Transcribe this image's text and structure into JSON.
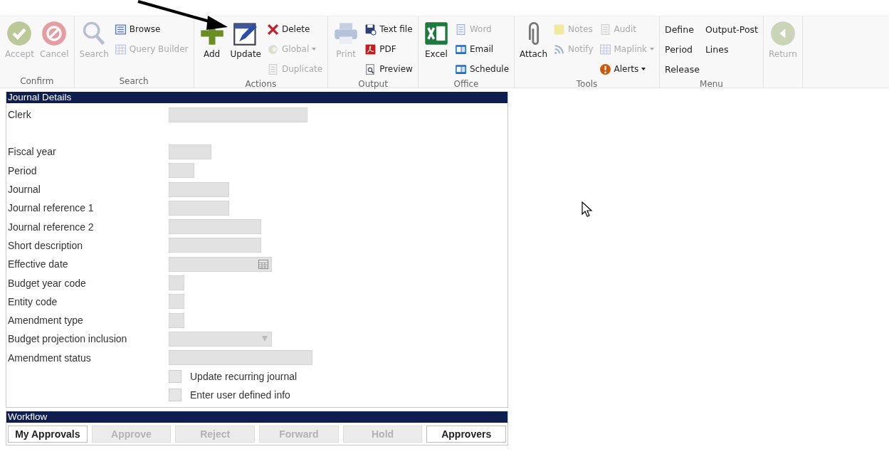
{
  "ribbon": {
    "groups": [
      {
        "label": "Confirm",
        "columns": [
          {
            "items": [
              {
                "kind": "large",
                "label": "Accept",
                "disabled": true
              }
            ]
          },
          {
            "items": [
              {
                "kind": "large",
                "label": "Cancel",
                "disabled": true
              }
            ]
          }
        ]
      },
      {
        "label": "Search",
        "columns": [
          {
            "items": [
              {
                "kind": "large",
                "label": "Search",
                "disabled": true
              }
            ]
          },
          {
            "items": [
              {
                "kind": "small",
                "label": "Browse",
                "disabled": false
              },
              {
                "kind": "small",
                "label": "Query Builder",
                "disabled": true
              }
            ]
          }
        ]
      },
      {
        "label": "Actions",
        "columns": [
          {
            "items": [
              {
                "kind": "large",
                "label": "Add",
                "disabled": false
              }
            ]
          },
          {
            "items": [
              {
                "kind": "large",
                "label": "Update",
                "disabled": false
              }
            ]
          },
          {
            "items": [
              {
                "kind": "small",
                "label": "Delete",
                "disabled": false
              },
              {
                "kind": "small",
                "label": "Global",
                "disabled": true,
                "dropdown": true
              },
              {
                "kind": "small",
                "label": "Duplicate",
                "disabled": true
              }
            ]
          }
        ]
      },
      {
        "label": "Output",
        "columns": [
          {
            "items": [
              {
                "kind": "large",
                "label": "Print",
                "disabled": true
              }
            ]
          },
          {
            "items": [
              {
                "kind": "small",
                "label": "Text file",
                "disabled": false
              },
              {
                "kind": "small",
                "label": "PDF",
                "disabled": false
              },
              {
                "kind": "small",
                "label": "Preview",
                "disabled": false
              }
            ]
          }
        ]
      },
      {
        "label": "Office",
        "columns": [
          {
            "items": [
              {
                "kind": "large",
                "label": "Excel",
                "disabled": false
              }
            ]
          },
          {
            "items": [
              {
                "kind": "small",
                "label": "Word",
                "disabled": true
              },
              {
                "kind": "small",
                "label": "Email",
                "disabled": false
              },
              {
                "kind": "small",
                "label": "Schedule",
                "disabled": false
              }
            ]
          }
        ]
      },
      {
        "label": "Tools",
        "columns": [
          {
            "items": [
              {
                "kind": "large",
                "label": "Attach",
                "disabled": false
              }
            ]
          },
          {
            "items": [
              {
                "kind": "small",
                "label": "Notes",
                "disabled": true
              },
              {
                "kind": "small",
                "label": "Notify",
                "disabled": true
              }
            ]
          },
          {
            "items": [
              {
                "kind": "small",
                "label": "Audit",
                "disabled": true
              },
              {
                "kind": "small",
                "label": "Maplink",
                "disabled": true,
                "dropdown": true
              },
              {
                "kind": "small",
                "label": "Alerts",
                "disabled": false,
                "dropdown": true
              }
            ]
          }
        ]
      },
      {
        "label": "Menu",
        "columns": [
          {
            "items": [
              {
                "kind": "text",
                "label": "Define",
                "disabled": false
              },
              {
                "kind": "text",
                "label": "Period",
                "disabled": false
              },
              {
                "kind": "text",
                "label": "Release",
                "disabled": false
              }
            ]
          },
          {
            "items": [
              {
                "kind": "text",
                "label": "Output-Post",
                "disabled": false
              },
              {
                "kind": "text",
                "label": "Lines",
                "disabled": false
              }
            ]
          }
        ]
      },
      {
        "columns": [
          {
            "items": [
              {
                "kind": "large",
                "label": "Return",
                "disabled": true
              }
            ]
          }
        ]
      }
    ]
  },
  "form": {
    "title": "Journal Details",
    "fields": [
      {
        "kind": "text",
        "label": "Clerk",
        "disabled": true
      },
      {
        "kind": "text",
        "label": "Fiscal year",
        "disabled": true
      },
      {
        "kind": "text",
        "label": "Period",
        "disabled": true
      },
      {
        "kind": "text",
        "label": "Journal",
        "disabled": true
      },
      {
        "kind": "text",
        "label": "Journal reference 1",
        "disabled": true
      },
      {
        "kind": "text",
        "label": "Journal reference 2",
        "disabled": true
      },
      {
        "kind": "text",
        "label": "Short description",
        "disabled": true
      },
      {
        "kind": "date",
        "label": "Effective date",
        "disabled": true
      },
      {
        "kind": "text",
        "label": "Budget year code",
        "disabled": true
      },
      {
        "kind": "text",
        "label": "Entity code",
        "disabled": true
      },
      {
        "kind": "text",
        "label": "Amendment type",
        "disabled": true
      },
      {
        "kind": "select",
        "label": "Budget projection inclusion",
        "disabled": true
      },
      {
        "kind": "text",
        "label": "Amendment status",
        "disabled": true
      }
    ],
    "checkboxes": [
      {
        "label": "Update recurring journal",
        "checked": false
      },
      {
        "label": "Enter user defined info",
        "checked": false
      }
    ]
  },
  "workflow": {
    "title": "Workflow",
    "buttons": [
      {
        "label": "My Approvals",
        "disabled": false
      },
      {
        "label": "Approve",
        "disabled": true
      },
      {
        "label": "Reject",
        "disabled": true
      },
      {
        "label": "Forward",
        "disabled": true
      },
      {
        "label": "Hold",
        "disabled": true
      },
      {
        "label": "Approvers",
        "disabled": false
      }
    ]
  }
}
